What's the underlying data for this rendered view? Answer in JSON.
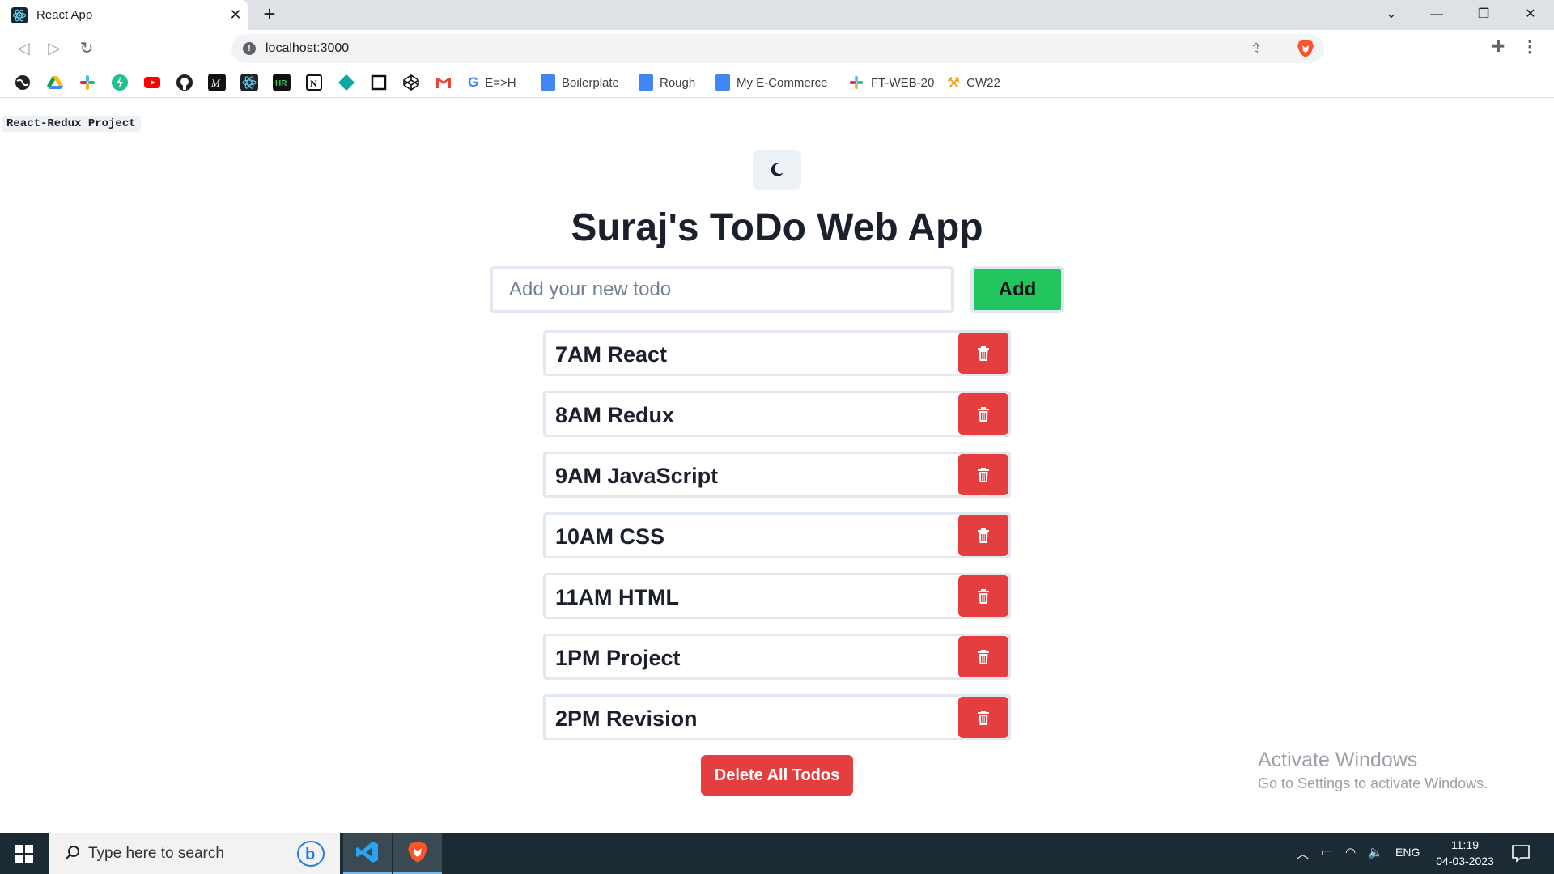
{
  "browser": {
    "tab_title": "React App",
    "url": "localhost:3000",
    "bookmarks": [
      {
        "label": "E=>H",
        "color": "#4285f4"
      },
      {
        "label": "Boilerplate",
        "color": "#4285f4"
      },
      {
        "label": "Rough",
        "color": "#4285f4"
      },
      {
        "label": "My E-Commerce",
        "color": "#4285f4"
      },
      {
        "label": "FT-WEB-20",
        "color": "#e01e5a"
      },
      {
        "label": "CW22",
        "color": "#f59e0b"
      }
    ]
  },
  "app": {
    "brand": "React-Redux Project",
    "title": "Suraj's ToDo Web App",
    "input_placeholder": "Add your new todo",
    "add_label": "Add",
    "todos": [
      "7AM React",
      "8AM Redux",
      "9AM JavaScript",
      "10AM CSS",
      "11AM HTML",
      "1PM Project",
      "2PM Revision"
    ],
    "delete_all_label": "Delete All Todos"
  },
  "watermark": {
    "line1": "Activate Windows",
    "line2": "Go to Settings to activate Windows."
  },
  "taskbar": {
    "search_placeholder": "Type here to search",
    "language": "ENG",
    "time": "11:19",
    "date": "04-03-2023"
  },
  "colors": {
    "add_button": "#22c55e",
    "delete_button": "#e53e3e",
    "taskbar": "#1c2b33"
  }
}
